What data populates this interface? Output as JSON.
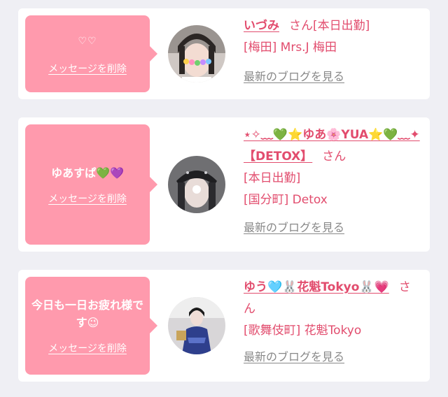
{
  "colors": {
    "background": "#efeff4",
    "card": "#ffffff",
    "bubble": "#ff9aad",
    "accent": "#e24d6e",
    "link_gray": "#888888"
  },
  "messages": [
    {
      "text": "♡♡",
      "delete_label": "メッセージを削除",
      "name": "いづみ",
      "honorific": "さん",
      "status": "[本日出勤]",
      "store": "[梅田] Mrs.J 梅田",
      "blog_link": "最新のブログを見る"
    },
    {
      "text": "ゆあすぱ💚💜",
      "delete_label": "メッセージを削除",
      "name": "⋆✧﹏💚⭐ゆあ🌸YUA⭐💚﹏✦【DETOX】",
      "honorific": "さん",
      "status": "[本日出勤]",
      "store": "[国分町] Detox",
      "blog_link": "最新のブログを見る"
    },
    {
      "text": "今日も一日お疲れ様です😉",
      "delete_label": "メッセージを削除",
      "name": "ゆう🩵🐰花魁Tokyo🐰💗",
      "honorific": "さん",
      "status": "",
      "store": "[歌舞伎町] 花魁Tokyo",
      "blog_link": "最新のブログを見る"
    }
  ]
}
